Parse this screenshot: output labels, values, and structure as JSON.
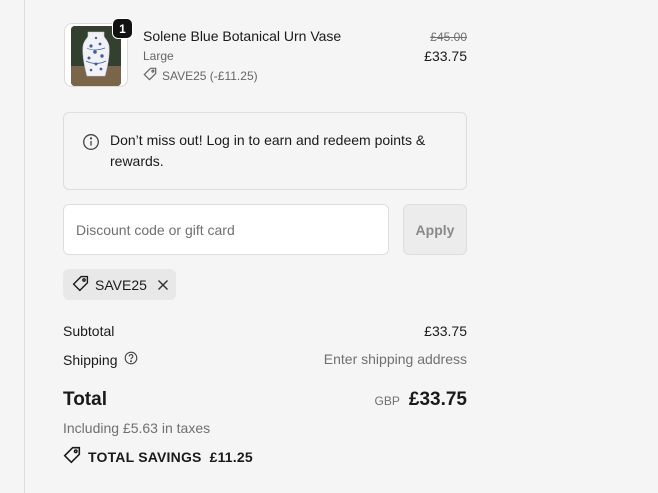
{
  "product": {
    "quantity": "1",
    "name": "Solene Blue Botanical Urn Vase",
    "variant": "Large",
    "discount_code_label": "SAVE25 (-£11.25)",
    "original_price": "£45.00",
    "price": "£33.75"
  },
  "info": {
    "message": "Don’t miss out! Log in to earn and redeem points & rewards."
  },
  "discount": {
    "placeholder": "Discount code or gift card",
    "apply_label": "Apply",
    "applied_code": "SAVE25"
  },
  "summary": {
    "subtotal_label": "Subtotal",
    "subtotal_value": "£33.75",
    "shipping_label": "Shipping",
    "shipping_value": "Enter shipping address",
    "total_label": "Total",
    "currency": "GBP",
    "total_value": "£33.75",
    "tax_note": "Including £5.63 in taxes",
    "savings_label": "TOTAL SAVINGS",
    "savings_value": "£11.25"
  },
  "colors": {
    "background": "#f5f5f5",
    "border": "#dedede",
    "text": "#1a1a1a",
    "muted": "#707070"
  }
}
